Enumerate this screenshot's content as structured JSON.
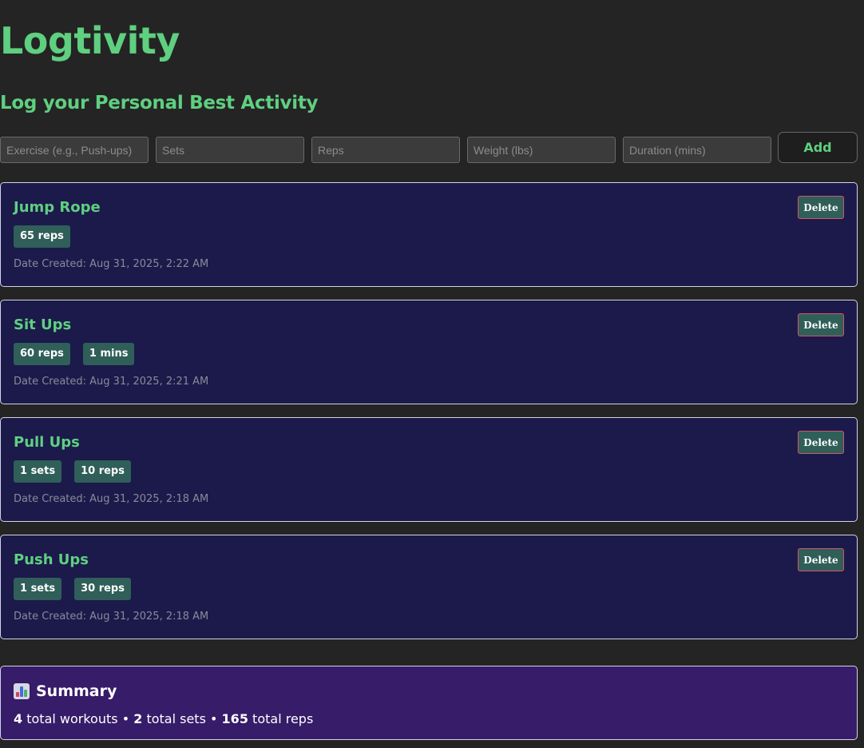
{
  "app": {
    "title": "Logtivity",
    "subtitle": "Log your Personal Best Activity"
  },
  "form": {
    "exercise_placeholder": "Exercise (e.g., Push-ups)",
    "sets_placeholder": "Sets",
    "reps_placeholder": "Reps",
    "weight_placeholder": "Weight (lbs)",
    "duration_placeholder": "Duration (mins)",
    "add_label": "Add"
  },
  "workouts": [
    {
      "name": "Jump Rope",
      "badges": [
        "65 reps"
      ],
      "date": "Date Created: Aug 31, 2025, 2:22 AM",
      "delete_label": "Delete"
    },
    {
      "name": "Sit Ups",
      "badges": [
        "60 reps",
        "1 mins"
      ],
      "date": "Date Created: Aug 31, 2025, 2:21 AM",
      "delete_label": "Delete"
    },
    {
      "name": "Pull Ups",
      "badges": [
        "1 sets",
        "10 reps"
      ],
      "date": "Date Created: Aug 31, 2025, 2:18 AM",
      "delete_label": "Delete"
    },
    {
      "name": "Push Ups",
      "badges": [
        "1 sets",
        "30 reps"
      ],
      "date": "Date Created: Aug 31, 2025, 2:18 AM",
      "delete_label": "Delete"
    }
  ],
  "summary": {
    "icon": "bar-chart-icon",
    "title": "Summary",
    "total_workouts": "4",
    "workouts_label": "total workouts",
    "total_sets": "2",
    "sets_label": "total sets",
    "total_reps": "165",
    "reps_label": "total reps",
    "separator": "•"
  },
  "colors": {
    "accent_green": "#5fcf80",
    "card_bg": "#1b1a4b",
    "badge_bg": "#2f5f58",
    "summary_bg": "#361c69",
    "page_bg": "#242424",
    "delete_border": "#d4546a"
  }
}
